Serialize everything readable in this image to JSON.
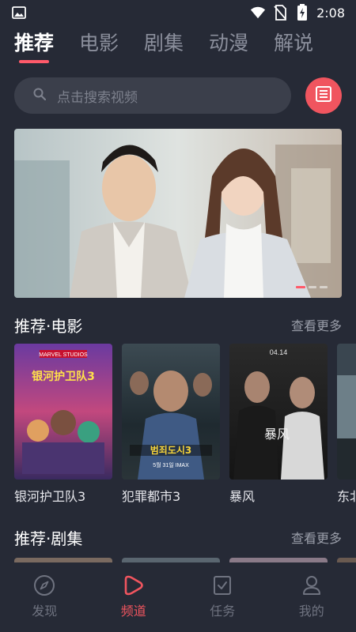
{
  "status_bar": {
    "time": "2:08",
    "icons": [
      "image-icon",
      "wifi-icon",
      "no-sim-icon",
      "battery-charging-icon"
    ]
  },
  "tabs": [
    {
      "label": "推荐",
      "active": true
    },
    {
      "label": "电影",
      "active": false
    },
    {
      "label": "剧集",
      "active": false
    },
    {
      "label": "动漫",
      "active": false
    },
    {
      "label": "解说",
      "active": false
    }
  ],
  "search": {
    "placeholder": "点击搜索视频",
    "icon": "search-icon",
    "side_button_icon": "list-icon"
  },
  "banner": {
    "slide_count": 3,
    "active_slide": 1
  },
  "sections": {
    "movies": {
      "title": "推荐·电影",
      "more": "查看更多",
      "items": [
        {
          "title": "银河护卫队3",
          "poster_texts": [
            "MARVEL STUDIOS",
            "银河护卫队3"
          ]
        },
        {
          "title": "犯罪都市3",
          "poster_texts": [
            "5월 31일 IMAX"
          ]
        },
        {
          "title": "暴风",
          "poster_texts": [
            "04.14",
            "暴风"
          ]
        },
        {
          "title": "东北"
        }
      ]
    },
    "dramas": {
      "title": "推荐·剧集",
      "more": "查看更多"
    }
  },
  "bottom_nav": [
    {
      "label": "发现",
      "icon": "compass-icon",
      "active": false
    },
    {
      "label": "频道",
      "icon": "play-icon",
      "active": true
    },
    {
      "label": "任务",
      "icon": "task-icon",
      "active": false
    },
    {
      "label": "我的",
      "icon": "user-icon",
      "active": false
    }
  ],
  "colors": {
    "background": "#262a36",
    "accent": "#f0555f",
    "search_bg": "#3b3f4b",
    "muted_text": "#8b8f9c"
  }
}
